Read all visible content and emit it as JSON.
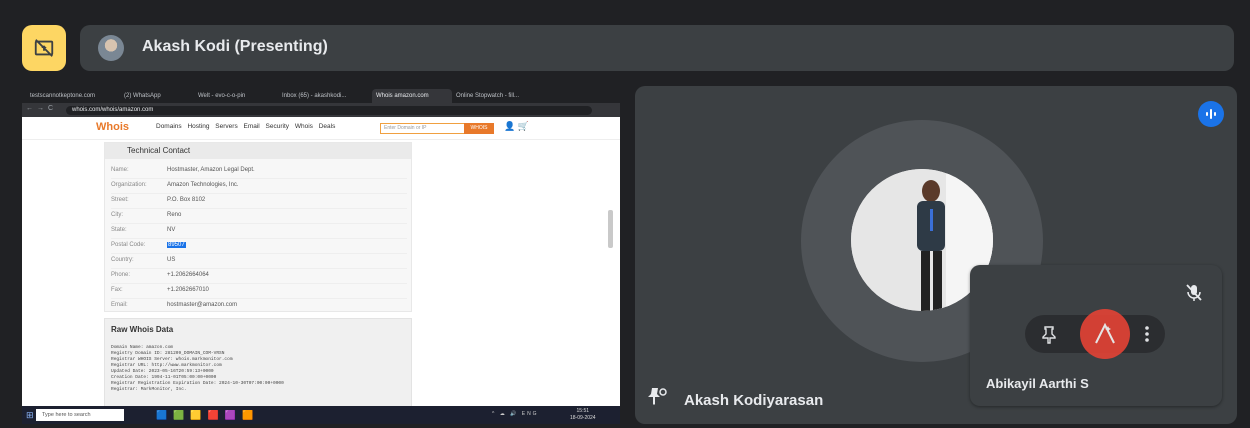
{
  "top_bar": {
    "present_icon": "present-to-all-off-icon",
    "presenter_name": "Akash Kodi (Presenting)"
  },
  "shared_screen": {
    "browser_tabs": [
      "testscannotkeptone.com",
      "(2) WhatsApp",
      "Welt - evo-c-o-pin",
      "Inbox (65) - akashkodi...",
      "Whois amazon.com",
      "Online Stopwatch - fill..."
    ],
    "url": "whois.com/whois/amazon.com",
    "site": {
      "logo": "Whois",
      "nav": "Domains  Hosting  Servers  Email  Security  Whois  Deals",
      "search_placeholder": "Enter Domain or IP",
      "search_button": "WHOIS"
    },
    "tech_contact": {
      "title": "Technical Contact",
      "rows": [
        {
          "k": "Name:",
          "v": "Hostmaster, Amazon Legal Dept."
        },
        {
          "k": "Organization:",
          "v": "Amazon Technologies, Inc."
        },
        {
          "k": "Street:",
          "v": "P.O. Box 8102"
        },
        {
          "k": "City:",
          "v": "Reno"
        },
        {
          "k": "State:",
          "v": "NV"
        },
        {
          "k": "Postal Code:",
          "v": "89507"
        },
        {
          "k": "Country:",
          "v": "US"
        },
        {
          "k": "Phone:",
          "v": "+1.2062664064"
        },
        {
          "k": "Fax:",
          "v": "+1.2062667010"
        },
        {
          "k": "Email:",
          "v": "hostmaster@amazon.com"
        }
      ]
    },
    "raw_whois": {
      "title": "Raw Whois Data",
      "text": "Domain Name: amazon.com\nRegistry Domain ID: 281209_DOMAIN_COM-VRSN\nRegistrar WHOIS Server: whois.markmonitor.com\nRegistrar URL: http://www.markmonitor.com\nUpdated Date: 2023-05-16T20:59:13+0000\nCreation Date: 1994-11-01T05:00:00+0000\nRegistrar Registration Expiration Date: 2024-10-30T07:00:00+0000\nRegistrar: MarkMonitor, Inc."
    },
    "taskbar": {
      "search_placeholder": "Type here to search",
      "clock_time": "15:51",
      "clock_date": "18-09-2024"
    }
  },
  "main_tile": {
    "participant_name": "Akash Kodiyarasan",
    "pin_icon": "pinned-person-icon",
    "speaking_icon": "speaking-indicator-icon"
  },
  "small_tile": {
    "participant_name": "Abikayil Aarthi S",
    "mic_icon": "mic-off-icon",
    "controls": [
      "pin-icon",
      "visual-effects-icon",
      "more-options-icon"
    ]
  },
  "colors": {
    "background": "#202124",
    "tile": "#3c4043",
    "present_button": "#fdd663",
    "speaking": "#1a73e8",
    "effects": "#ea4335"
  }
}
